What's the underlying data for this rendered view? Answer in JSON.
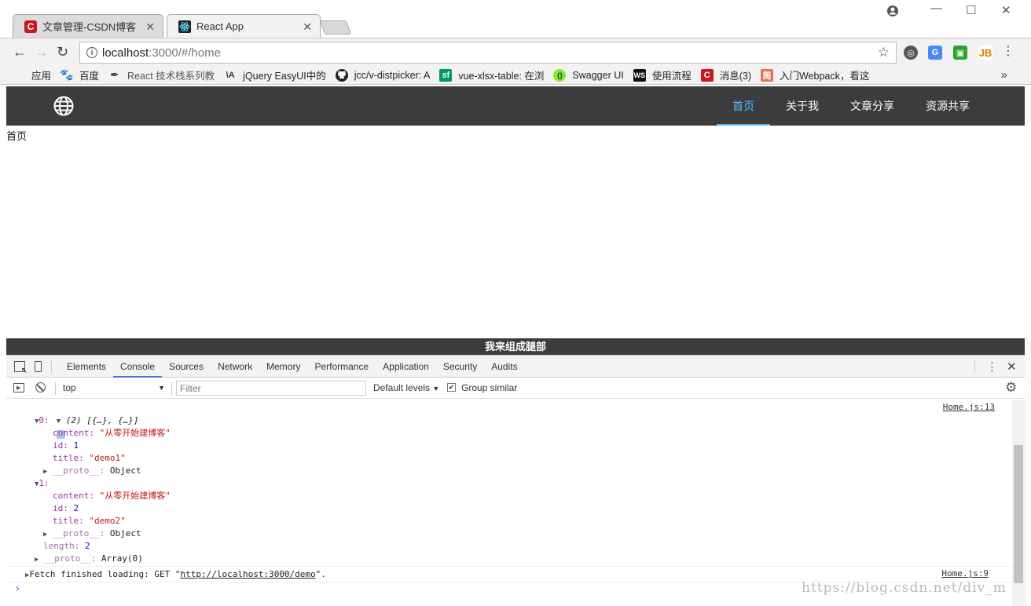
{
  "browser": {
    "tabs": [
      {
        "title": "文章管理-CSDN博客",
        "icon": "csdn-icon",
        "active": false
      },
      {
        "title": "React App",
        "icon": "react-icon",
        "active": true
      }
    ],
    "close_glyph": "✕",
    "address": {
      "host": "localhost",
      "path": ":3000/#/home"
    },
    "bookmarks": [
      {
        "label": "应用",
        "icon": "apps-grid-icon"
      },
      {
        "label": "百度",
        "icon": "baidu-paw-icon"
      },
      {
        "label": "React 技术栈系列教",
        "icon": "feather-icon"
      },
      {
        "label": "jQuery EasyUI中的",
        "icon": "jquery-icon"
      },
      {
        "label": "jcc/v-distpicker: A",
        "icon": "github-icon"
      },
      {
        "label": "vue-xlsx-table: 在浏",
        "icon": "sf-icon"
      },
      {
        "label": "Swagger UI",
        "icon": "swagger-icon"
      },
      {
        "label": "使用流程",
        "icon": "ws-icon"
      },
      {
        "label": "消息(3)",
        "icon": "csdn-icon"
      },
      {
        "label": "入门Webpack，看这",
        "icon": "jianshu-icon"
      }
    ],
    "more_bookmarks": "»"
  },
  "app": {
    "nav": [
      {
        "label": "首页",
        "active": true
      },
      {
        "label": "关于我",
        "active": false
      },
      {
        "label": "文章分享",
        "active": false
      },
      {
        "label": "资源共享",
        "active": false
      }
    ],
    "content": "首页",
    "footer": "我来组成腿部"
  },
  "devtools": {
    "tabs": [
      "Elements",
      "Console",
      "Sources",
      "Network",
      "Memory",
      "Performance",
      "Application",
      "Security",
      "Audits"
    ],
    "active_tab": "Console",
    "context": "top",
    "filter_placeholder": "Filter",
    "levels": "Default levels",
    "group_similar": "Group similar",
    "console": {
      "array_summary": "(2) [{…}, {…}]",
      "source1": "Home.js:13",
      "items": [
        {
          "index": "0:",
          "content_key": "content:",
          "content": "\"从零开始建博客\"",
          "id_key": "id:",
          "id": "1",
          "title_key": "title:",
          "title": "\"demo1\"",
          "proto_key": "__proto__:",
          "proto": "Object"
        },
        {
          "index": "1:",
          "content_key": "content:",
          "content": "\"从零开始建博客\"",
          "id_key": "id:",
          "id": "2",
          "title_key": "title:",
          "title": "\"demo2\"",
          "proto_key": "__proto__:",
          "proto": "Object"
        }
      ],
      "length_key": "length:",
      "length": "2",
      "array_proto_key": "__proto__:",
      "array_proto": "Array(0)",
      "fetch_prefix": "Fetch finished loading: GET \"",
      "fetch_url": "http://localhost:3000/demo",
      "fetch_suffix": "\".",
      "source2": "Home.js:9",
      "prompt": "›"
    }
  },
  "watermark": "https://blog.csdn.net/div_m",
  "colors": {
    "navbar": "#3c3c3c",
    "active_link": "#58b7ff",
    "csdn_red": "#c9161f"
  }
}
